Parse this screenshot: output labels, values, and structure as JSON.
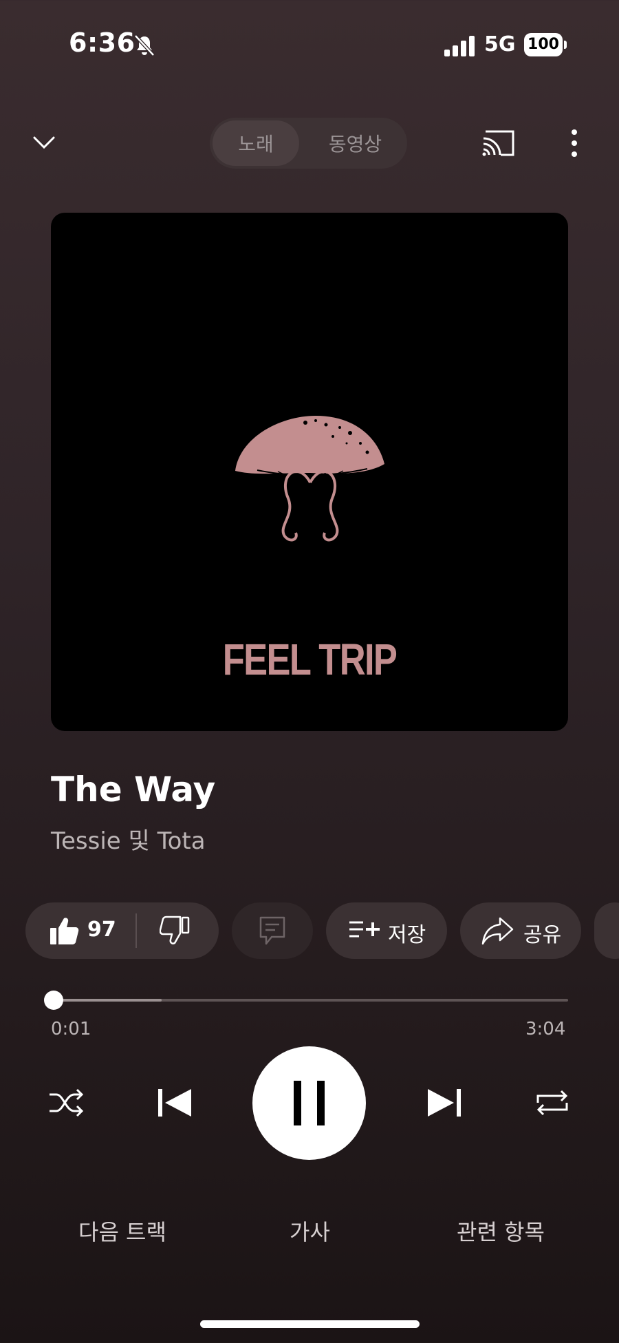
{
  "status_bar": {
    "time": "6:36",
    "network": "5G",
    "battery": "100",
    "icons": [
      "bell-slash-icon",
      "signal-icon",
      "battery-icon"
    ]
  },
  "top_bar": {
    "collapse_icon": "chevron-down-icon",
    "toggle": {
      "song": "노래",
      "video": "동영상",
      "selected": "song"
    },
    "cast_icon": "cast-icon",
    "more_icon": "more-vertical-icon"
  },
  "album_art": {
    "text": "FEEL TRIP",
    "text_color": "#c38e8f",
    "background": "#000000"
  },
  "song": {
    "title": "The Way",
    "artist": "Tessie 및 Tota"
  },
  "actions": {
    "like_count": "97",
    "save_label": "저장",
    "share_label": "공유"
  },
  "progress": {
    "current": "0:01",
    "total": "3:04",
    "played_fraction": 0.005,
    "buffered_fraction": 0.21
  },
  "controls": {
    "state": "playing",
    "icons": [
      "shuffle-icon",
      "skip-previous-icon",
      "pause-icon",
      "skip-next-icon",
      "repeat-icon"
    ]
  },
  "bottom_tabs": {
    "next": "다음 트랙",
    "lyrics": "가사",
    "related": "관련 항목"
  },
  "colors": {
    "accent_pink": "#c38e8f",
    "chip_bg": "#3b3133",
    "text_secondary": "#bcb5b6"
  }
}
